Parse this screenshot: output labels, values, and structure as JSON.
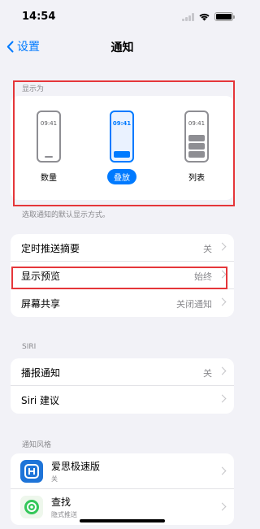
{
  "status_bar": {
    "time": "14:54"
  },
  "nav": {
    "back_label": "设置",
    "title": "通知"
  },
  "display_as": {
    "header": "显示为",
    "options": [
      {
        "time": "09:41",
        "label": "数量"
      },
      {
        "time": "09:41",
        "label": "叠放"
      },
      {
        "time": "09:41",
        "label": "列表"
      }
    ],
    "selected": "叠放",
    "footer": "选取通知的默认显示方式。"
  },
  "general": {
    "rows": [
      {
        "label": "定时推送摘要",
        "value": "关"
      },
      {
        "label": "显示预览",
        "value": "始终"
      },
      {
        "label": "屏幕共享",
        "value": "关闭通知"
      }
    ]
  },
  "siri": {
    "header": "SIRI",
    "rows": [
      {
        "label": "播报通知",
        "value": "关"
      },
      {
        "label": "Siri 建议",
        "value": ""
      }
    ]
  },
  "notification_style": {
    "header": "通知风格",
    "apps": [
      {
        "name": "爱思极速版",
        "subtitle": "关",
        "icon": "aisi-app-icon",
        "color": "#1e74d8"
      },
      {
        "name": "查找",
        "subtitle": "隐式推送",
        "icon": "find-my-app-icon",
        "color": "#34c759"
      }
    ]
  },
  "colors": {
    "accent": "#007aff",
    "highlight": "#e5363a",
    "background": "#f2f2f7"
  }
}
